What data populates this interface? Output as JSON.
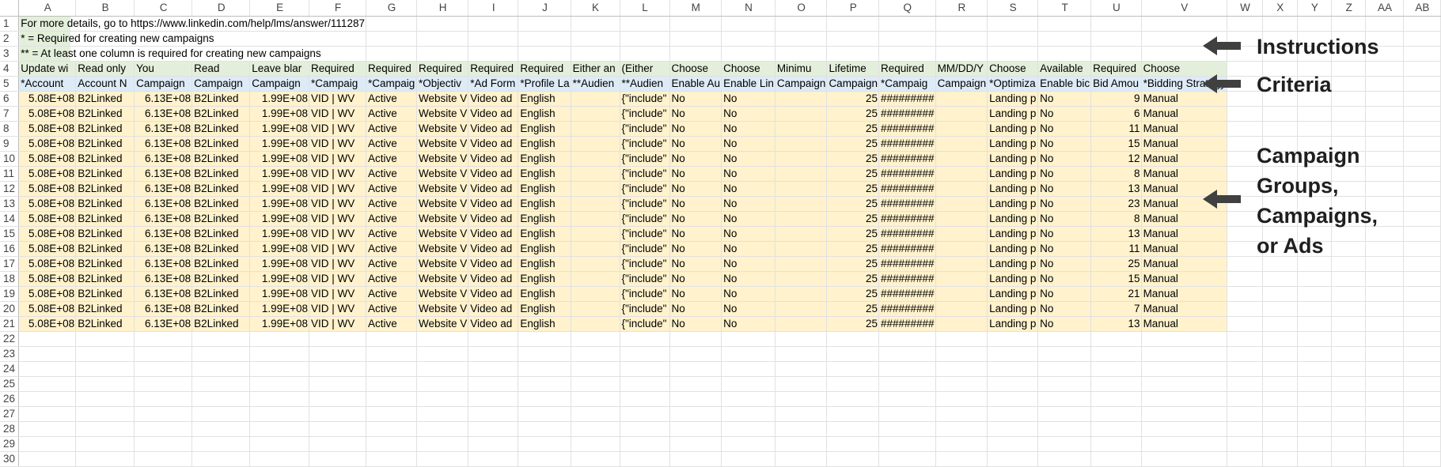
{
  "columns": [
    "A",
    "B",
    "C",
    "D",
    "E",
    "F",
    "G",
    "H",
    "I",
    "J",
    "K",
    "L",
    "M",
    "N",
    "O",
    "P",
    "Q",
    "R",
    "S",
    "T",
    "U",
    "V",
    "W",
    "X",
    "Y",
    "Z",
    "AA",
    "AB"
  ],
  "instructions": [
    "For more details, go to https://www.linkedin.com/help/lms/answer/111287",
    "* = Required for creating new campaigns",
    "** = At least one column is required for creating new campaigns"
  ],
  "criteria_row": [
    "Update wi",
    "Read only",
    "You",
    "Read",
    "Leave blar",
    "Required",
    "Required",
    "Required",
    "Required",
    "Required",
    "Either an",
    "(Either",
    "Choose",
    "Choose",
    "Minimu",
    "Lifetime",
    "Required",
    "MM/DD/Y",
    "Choose",
    "Available",
    "Required",
    "Choose"
  ],
  "header_row": [
    "*Account",
    "Account N",
    "Campaign",
    "Campaign",
    "Campaign",
    "*Campaig",
    "*Campaig",
    "*Objectiv",
    "*Ad Form",
    "*Profile La",
    "**Audien",
    "**Audien",
    "Enable Au",
    "Enable Lin",
    "Campaign",
    "Campaign",
    "*Campaig",
    "Campaign",
    "*Optimiza",
    "Enable bic",
    "Bid Amou",
    "*Bidding Strategy"
  ],
  "row_template": [
    "5.08E+08",
    "B2Linked",
    "6.13E+08",
    "B2Linked",
    "1.99E+08",
    "VID | WV",
    "Active",
    "Website V",
    "Video ad",
    "English",
    "",
    "{\"include\"",
    "No",
    "No",
    "",
    "25",
    "#########",
    "",
    "Landing p",
    "No",
    "",
    "Manual"
  ],
  "bid_amounts": [
    "9",
    "6",
    "11",
    "15",
    "12",
    "8",
    "13",
    "23",
    "8",
    "13",
    "11",
    "25",
    "15",
    "21",
    "7",
    "13"
  ],
  "annotations": [
    {
      "label_lines": [
        "Instructions"
      ]
    },
    {
      "label_lines": [
        "Criteria"
      ]
    },
    {
      "label_lines": [
        "Campaign",
        "Groups,",
        "Campaigns,",
        "or Ads"
      ]
    }
  ],
  "colors": {
    "instructions_fill": "#e3efda",
    "criteria_fill": "#ddebf7",
    "data_fill": "#fff2cc",
    "arrow": "#404040",
    "gridline": "#e1e1e1"
  },
  "total_rows": 30
}
